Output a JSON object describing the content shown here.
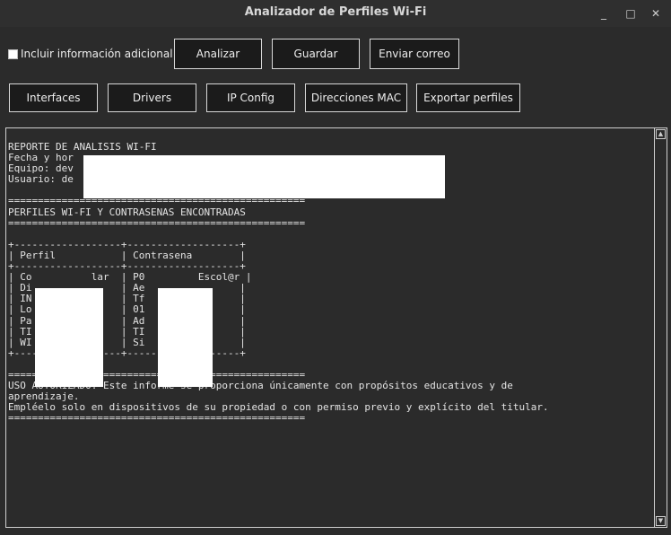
{
  "window": {
    "title": "Analizador de Perfiles Wi-Fi",
    "minimize_glyph": "_",
    "maximize_glyph": "□",
    "close_glyph": "✕"
  },
  "toolbar": {
    "include_info_label": "Incluir información adicional",
    "include_info_checked": false,
    "analyze_label": "Analizar",
    "save_label": "Guardar",
    "send_email_label": "Enviar correo"
  },
  "tools": {
    "interfaces_label": "Interfaces",
    "drivers_label": "Drivers",
    "ipconfig_label": "IP Config",
    "mac_label": "Direcciones MAC",
    "export_label": "Exportar perfiles"
  },
  "report": {
    "lines": [
      "REPORTE DE ANALISIS WI-FI",
      "Fecha y hor",
      "Equipo: dev",
      "Usuario: de",
      "",
      "==================================================",
      "PERFILES WI-FI Y CONTRASENAS ENCONTRADAS",
      "==================================================",
      "",
      "+------------------+-------------------+",
      "| Perfil           | Contrasena        |",
      "+------------------+-------------------+",
      "| Co          lar  | P0         Escol@r |",
      "| Di               | Ae                |",
      "| IN          F    | Tf                |",
      "| Lo               | 01         1      |",
      "| Pa          CA   | Ad         A1     |",
      "| TI               | TI                |",
      "| WI               | Si                |",
      "+------------------+-------------------+",
      "",
      "==================================================",
      "USO AUTORIZADO: Este informe se proporciona únicamente con propósitos educativos y de",
      "aprendizaje.",
      "Empléelo solo en dispositivos de su propiedad o con permiso previo y explícito del titular.",
      "=================================================="
    ]
  },
  "scrollbar": {
    "up_glyph": "▲",
    "down_glyph": "▼"
  }
}
